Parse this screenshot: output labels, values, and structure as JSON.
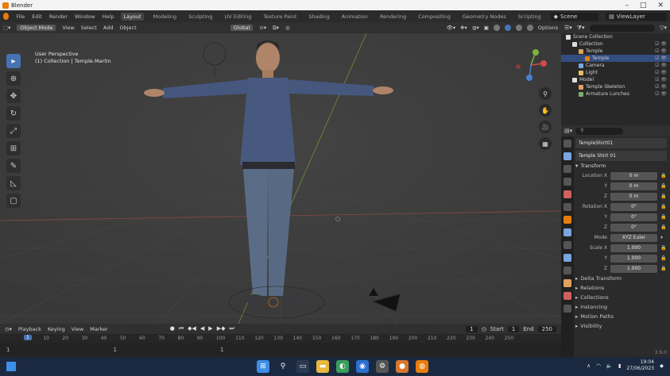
{
  "window": {
    "title": "Blender",
    "minimize": "–",
    "maximize": "□",
    "close": "✕"
  },
  "menubar": {
    "menus": [
      "File",
      "Edit",
      "Render",
      "Window",
      "Help"
    ],
    "workspaces": [
      "Layout",
      "Modeling",
      "Sculpting",
      "UV Editing",
      "Texture Paint",
      "Shading",
      "Animation",
      "Rendering",
      "Compositing",
      "Geometry Nodes",
      "Scripting"
    ],
    "active_workspace": "Layout",
    "scene": "Scene",
    "view_layer": "ViewLayer"
  },
  "viewport": {
    "mode": "Object Mode",
    "menus": [
      "View",
      "Select",
      "Add",
      "Object"
    ],
    "transform_orientation": "Global",
    "options": "Options",
    "view_name": "User Perspective",
    "view_context": "(1) Collection | Temple.Martin"
  },
  "timeline": {
    "menus": [
      "Playback",
      "Keying",
      "View",
      "Marker"
    ],
    "current_frame": "1",
    "start_label": "Start",
    "start": "1",
    "end_label": "End",
    "end": "250",
    "ruler": [
      "0",
      "10",
      "20",
      "30",
      "40",
      "50",
      "60",
      "70",
      "80",
      "90",
      "100",
      "110",
      "120",
      "130",
      "140",
      "150",
      "160",
      "170",
      "180",
      "190",
      "200",
      "210",
      "220",
      "230",
      "240",
      "250"
    ],
    "lower_markers": [
      "1",
      "1",
      "1"
    ]
  },
  "outliner": {
    "rows": [
      {
        "label": "Scene Collection",
        "indent": 0
      },
      {
        "label": "Collection",
        "indent": 1
      },
      {
        "label": "Temple",
        "indent": 2
      },
      {
        "label": "Temple",
        "indent": 3
      },
      {
        "label": "Camera",
        "indent": 2
      },
      {
        "label": "Light",
        "indent": 2
      },
      {
        "label": "Model",
        "indent": 1
      },
      {
        "label": "Temple Skeleton",
        "indent": 2
      },
      {
        "label": "Armature Lunches",
        "indent": 2
      }
    ]
  },
  "properties": {
    "object_name": "TempleShirt01",
    "mesh_name": "Temple Shirt 01",
    "transform": "Transform",
    "location_label": "Location X",
    "location": [
      "0 m",
      "0 m",
      "0 m"
    ],
    "rotation_label": "Rotation X",
    "rotation": [
      "0°",
      "0°",
      "0°"
    ],
    "mode_label": "Mode",
    "mode_value": "XYZ Euler",
    "scale_label": "Scale X",
    "scale": [
      "1.000",
      "1.000",
      "1.000"
    ],
    "axis_y": "Y",
    "axis_z": "Z",
    "sections": [
      "Delta Transform",
      "Relations",
      "Collections",
      "Instancing",
      "Motion Paths",
      "Visibility"
    ],
    "version": "3.6.0"
  },
  "taskbar": {
    "time": "19:04",
    "date": "27/06/2023"
  }
}
